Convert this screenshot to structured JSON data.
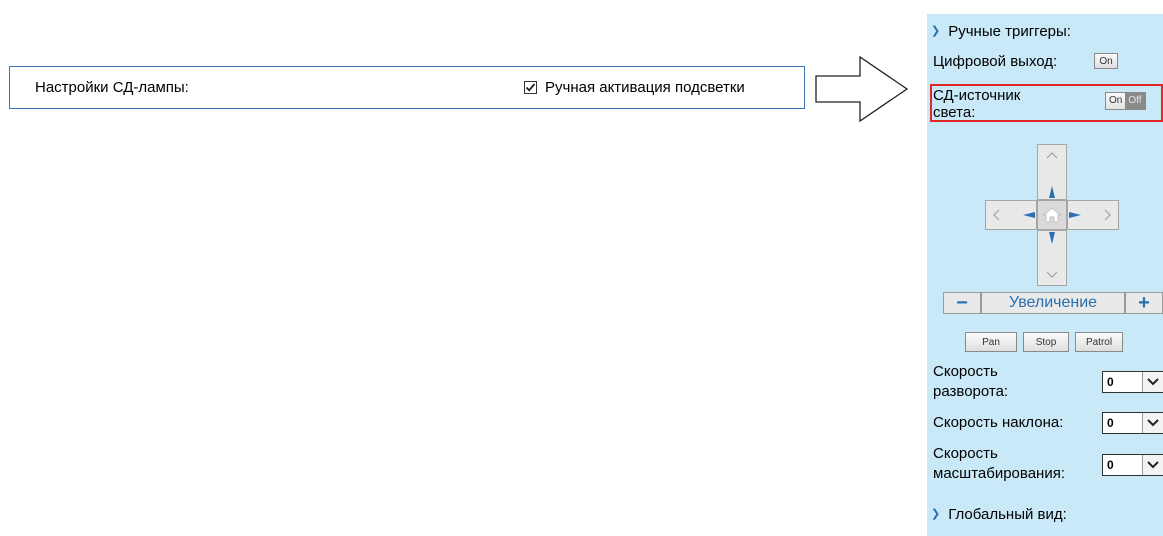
{
  "led_settings": {
    "title": "Настройки СД-лампы:",
    "checkbox_label": "Ручная активация подсветки",
    "checkbox_checked": true
  },
  "panel": {
    "manual_triggers_label": "Ручные триггеры:",
    "digital_output_label": "Цифровой выход:",
    "digital_output_on": "On",
    "led_source_label_line1": "СД-источник",
    "led_source_label_line2": "света:",
    "led_on": "On",
    "led_off": "Off",
    "zoom_minus": "−",
    "zoom_label": "Увеличение",
    "zoom_plus": "+",
    "pan_label": "Pan",
    "stop_label": "Stop",
    "patrol_label": "Patrol",
    "pan_speed_label_line1": "Скорость",
    "pan_speed_label_line2": "разворота:",
    "pan_speed_value": "0",
    "tilt_speed_label": "Скорость наклона:",
    "tilt_speed_value": "0",
    "zoom_speed_label_line1": "Скорость",
    "zoom_speed_label_line2": "масштабирования:",
    "zoom_speed_value": "0",
    "global_view_label": "Глобальный вид:"
  },
  "colors": {
    "panel_bg": "#c9e9f9",
    "accent_blue": "#2a6fb0",
    "highlight_red": "#e32626",
    "box_border": "#3b73b5"
  }
}
